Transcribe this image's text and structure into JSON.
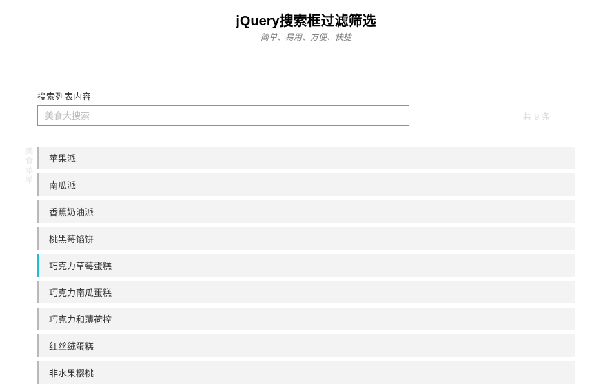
{
  "header": {
    "title": "jQuery搜索框过滤筛选",
    "subtitle": "简单、易用、方便、快捷"
  },
  "search": {
    "label": "搜索列表内容",
    "placeholder": "美食大搜索",
    "value": ""
  },
  "count_text": "共 9 条",
  "side_label": "美食菜单",
  "items": [
    "苹果派",
    "南瓜派",
    "香蕉奶油派",
    "桃黑莓馅饼",
    "巧克力草莓蛋糕",
    "巧克力南瓜蛋糕",
    "巧克力和薄荷控",
    "红丝绒蛋糕",
    "非水果樱桃"
  ],
  "active_index": 4
}
